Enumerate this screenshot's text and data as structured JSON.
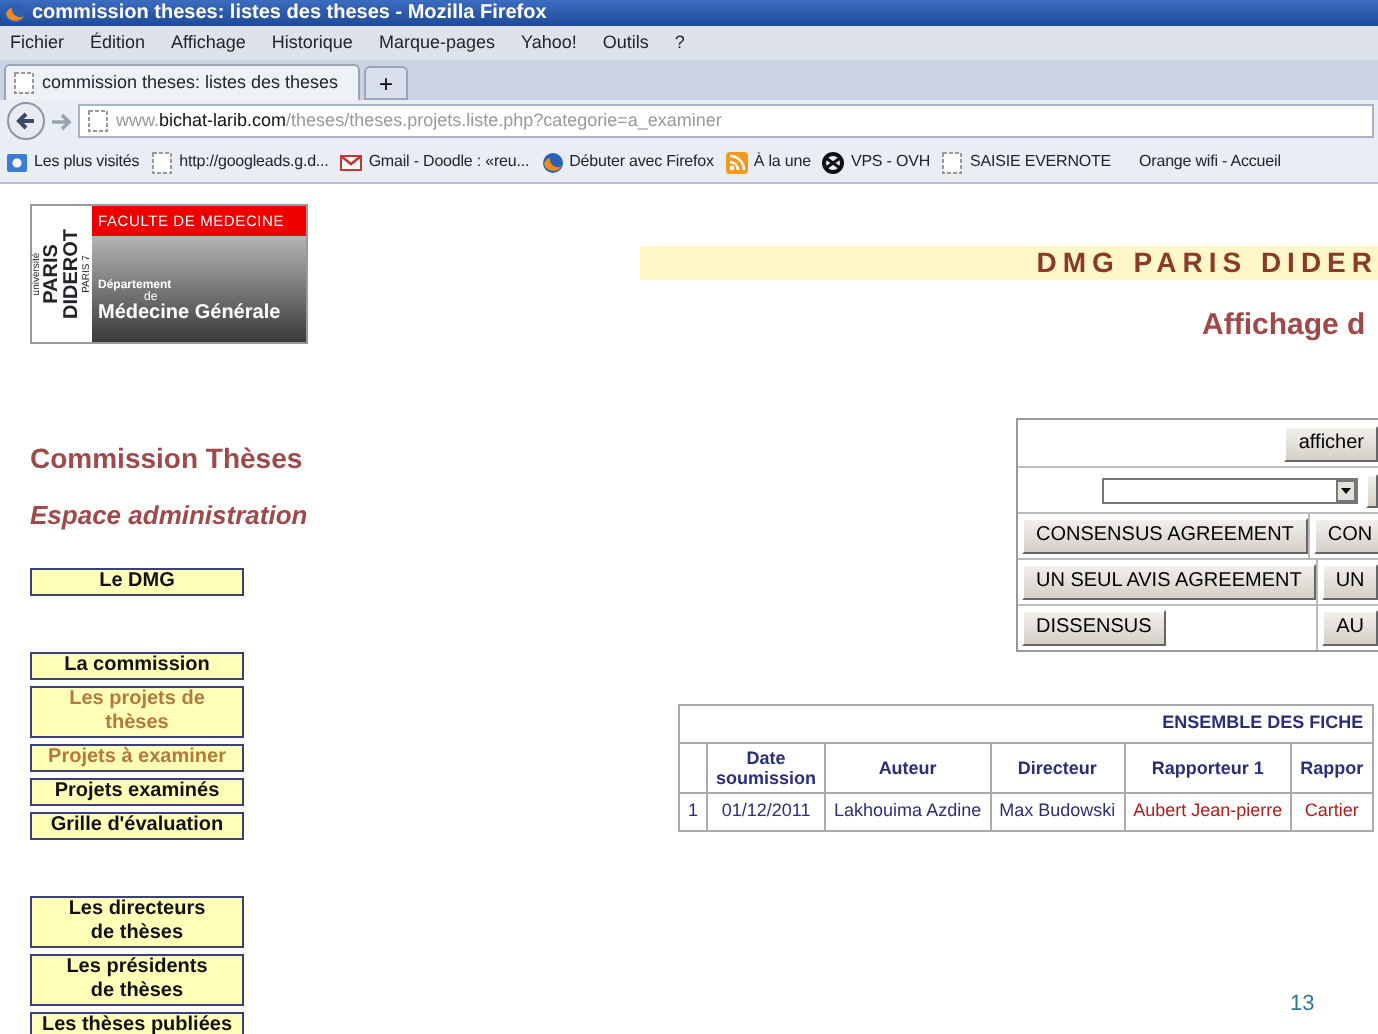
{
  "window": {
    "title": "commission theses: listes des theses - Mozilla Firefox"
  },
  "menu": [
    "Fichier",
    "Édition",
    "Affichage",
    "Historique",
    "Marque-pages",
    "Yahoo!",
    "Outils",
    "?"
  ],
  "tabs": [
    {
      "label": "commission theses: listes des theses",
      "selected": true
    }
  ],
  "new_tab": "+",
  "address": {
    "prefix": "www.",
    "domain": "bichat-larib.com",
    "path": "/theses/theses.projets.liste.php?categorie=a_examiner"
  },
  "bookmarks": [
    {
      "label": "Les plus visités",
      "kind": "visited"
    },
    {
      "label": "http://googleads.g.d...",
      "kind": "page"
    },
    {
      "label": "Gmail - Doodle : «reu...",
      "kind": "gmail"
    },
    {
      "label": "Débuter avec Firefox",
      "kind": "firefox"
    },
    {
      "label": "À la une",
      "kind": "feed"
    },
    {
      "label": "VPS - OVH",
      "kind": "vps"
    },
    {
      "label": "SAISIE EVERNOTE",
      "kind": "page"
    },
    {
      "label": "Orange wifi - Accueil",
      "kind": "none"
    }
  ],
  "logo": {
    "university": "université",
    "name": [
      "PARIS",
      "DIDEROT"
    ],
    "campus": "PARIS 7",
    "faculty": "FACULTE DE MEDECINE",
    "department": "Département",
    "of": "de",
    "discipline": "Médecine Générale"
  },
  "site_banner": "DMG PARIS DIDER",
  "page_heading": "Affichage d",
  "section_title": "Commission Thèses",
  "section_subtitle": "Espace administration",
  "nav_groups": [
    [
      {
        "label": "Le DMG",
        "selected": false
      }
    ],
    [
      {
        "label": "La commission",
        "selected": false
      },
      {
        "label": "Les projets de\nthèses",
        "selected": true
      },
      {
        "label": "Projets à examiner",
        "selected": true
      },
      {
        "label": "Projets examinés",
        "selected": false
      },
      {
        "label": "Grille d'évaluation",
        "selected": false
      }
    ],
    [
      {
        "label": "Les directeurs\nde thèses",
        "selected": false
      },
      {
        "label": "Les présidents\nde thèses",
        "selected": false
      },
      {
        "label": "Les thèses publiées",
        "selected": false
      }
    ]
  ],
  "filter_panel": {
    "show_button": "afficher",
    "buttons": [
      [
        "CONSENSUS AGREEMENT",
        "CON"
      ],
      [
        "UN SEUL AVIS AGREEMENT",
        "UN"
      ],
      [
        "DISSENSUS",
        "AU"
      ]
    ]
  },
  "table": {
    "caption": "ENSEMBLE DES FICHE",
    "columns": [
      {
        "label": "Date\nsoumission",
        "kind": "plain"
      },
      {
        "label": "Auteur",
        "kind": "plain"
      },
      {
        "label": "Directeur",
        "kind": "plain"
      },
      {
        "label": "Rapporteur 1",
        "kind": "rapporteur"
      },
      {
        "label": "Rappor",
        "kind": "rapporteur"
      }
    ],
    "rows": [
      {
        "number": "1",
        "cells": [
          "01/12/2011",
          "Lakhouima Azdine",
          "Max Budowski",
          "Aubert Jean-pierre",
          "Cartier"
        ]
      }
    ]
  },
  "slide_number": "13"
}
